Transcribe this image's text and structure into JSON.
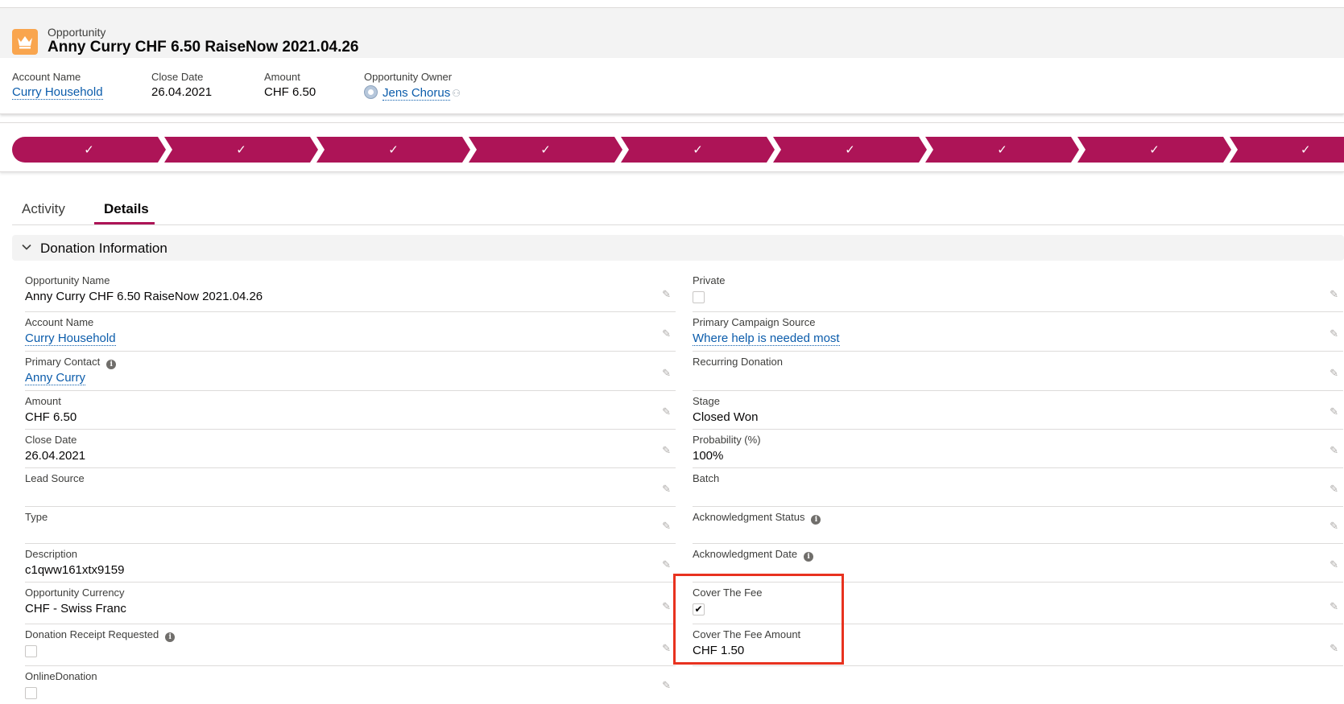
{
  "header": {
    "object_type": "Opportunity",
    "title": "Anny Curry CHF 6.50 RaiseNow 2021.04.26",
    "icon": "crown-icon"
  },
  "highlights": {
    "account_name": {
      "label": "Account Name",
      "value": "Curry Household"
    },
    "close_date": {
      "label": "Close Date",
      "value": "26.04.2021"
    },
    "amount": {
      "label": "Amount",
      "value": "CHF 6.50"
    },
    "owner": {
      "label": "Opportunity Owner",
      "value": "Jens Chorus"
    }
  },
  "path": {
    "stages": [
      "✓",
      "✓",
      "✓",
      "✓",
      "✓",
      "✓",
      "✓",
      "✓",
      "✓"
    ],
    "color": "#ad1457"
  },
  "tabs": [
    {
      "label": "Activity",
      "active": false
    },
    {
      "label": "Details",
      "active": true
    }
  ],
  "section": {
    "title": "Donation Information"
  },
  "fields_left": [
    {
      "label": "Opportunity Name",
      "value": "Anny Curry CHF 6.50 RaiseNow 2021.04.26",
      "type": "text"
    },
    {
      "label": "Account Name",
      "value": "Curry Household",
      "type": "link"
    },
    {
      "label": "Primary Contact",
      "value": "Anny Curry",
      "type": "link",
      "info": true
    },
    {
      "label": "Amount",
      "value": "CHF 6.50",
      "type": "text"
    },
    {
      "label": "Close Date",
      "value": "26.04.2021",
      "type": "text"
    },
    {
      "label": "Lead Source",
      "value": "",
      "type": "text"
    },
    {
      "label": "Type",
      "value": "",
      "type": "text"
    },
    {
      "label": "Description",
      "value": "c1qww161xtx9159",
      "type": "text"
    },
    {
      "label": "Opportunity Currency",
      "value": "CHF - Swiss Franc",
      "type": "text"
    },
    {
      "label": "Donation Receipt Requested",
      "value": "",
      "type": "checkbox",
      "checked": false,
      "info": true
    },
    {
      "label": "OnlineDonation",
      "value": "",
      "type": "checkbox",
      "checked": false
    }
  ],
  "fields_right": [
    {
      "label": "Private",
      "value": "",
      "type": "checkbox",
      "checked": false
    },
    {
      "label": "Primary Campaign Source",
      "value": "Where help is needed most",
      "type": "link"
    },
    {
      "label": "Recurring Donation",
      "value": "",
      "type": "text"
    },
    {
      "label": "Stage",
      "value": "Closed Won",
      "type": "text"
    },
    {
      "label": "Probability (%)",
      "value": "100%",
      "type": "text"
    },
    {
      "label": "Batch",
      "value": "",
      "type": "text"
    },
    {
      "label": "Acknowledgment Status",
      "value": "",
      "type": "text",
      "info": true
    },
    {
      "label": "Acknowledgment Date",
      "value": "",
      "type": "text",
      "info": true
    },
    {
      "label": "Cover The Fee",
      "value": "",
      "type": "checkbox",
      "checked": true
    },
    {
      "label": "Cover The Fee Amount",
      "value": "CHF 1.50",
      "type": "text"
    }
  ],
  "glyphs": {
    "pencil": "✎",
    "info": "i",
    "check": "✔"
  },
  "colors": {
    "brand": "#ad1457",
    "link": "#0b5cab",
    "highlight": "#e8321f",
    "object_icon": "#f9a54e"
  }
}
